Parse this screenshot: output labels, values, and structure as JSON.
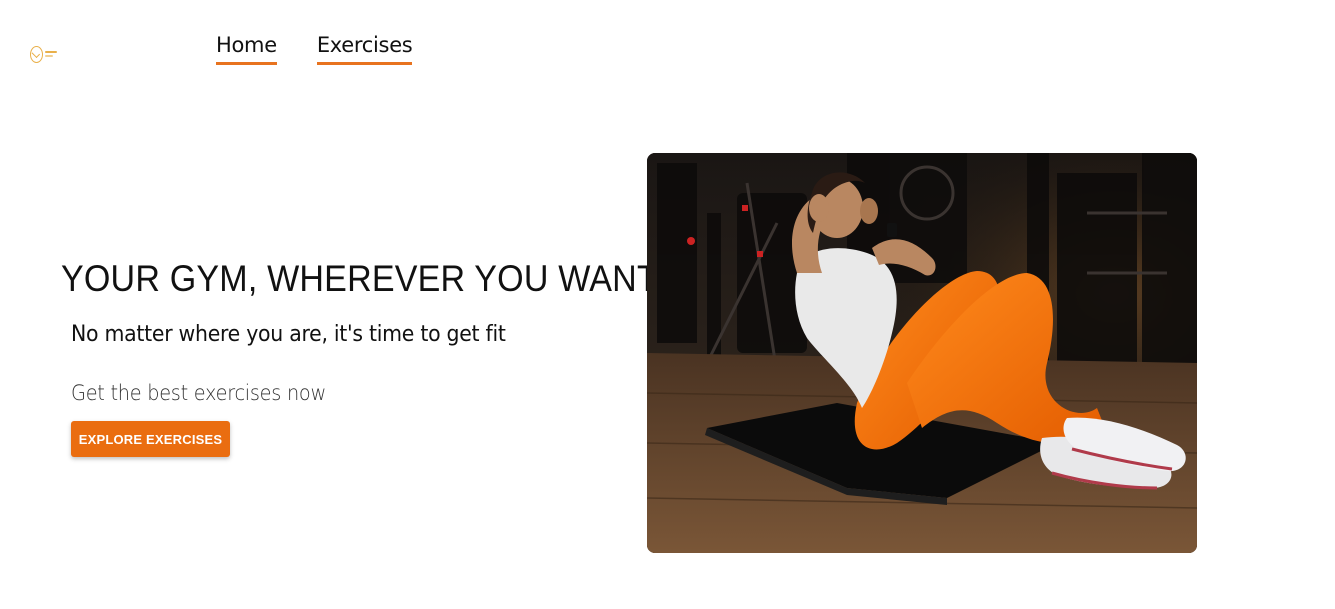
{
  "logo": {
    "icon": "gym-logo-icon"
  },
  "nav": {
    "items": [
      {
        "label": "Home"
      },
      {
        "label": "Exercises"
      }
    ]
  },
  "hero": {
    "title": "YOUR GYM, WHEREVER YOU WANT",
    "subtitle": "No matter where you are, it's time to get fit",
    "cta_text": "Get the best exercises now",
    "button_label": "EXPLORE EXERCISES",
    "image": {
      "subject": "hero-photo"
    }
  },
  "colors": {
    "accent": "#ea6d10",
    "nav_underline": "#e8731f",
    "logo": "#e9b04a",
    "text": "#111111"
  }
}
